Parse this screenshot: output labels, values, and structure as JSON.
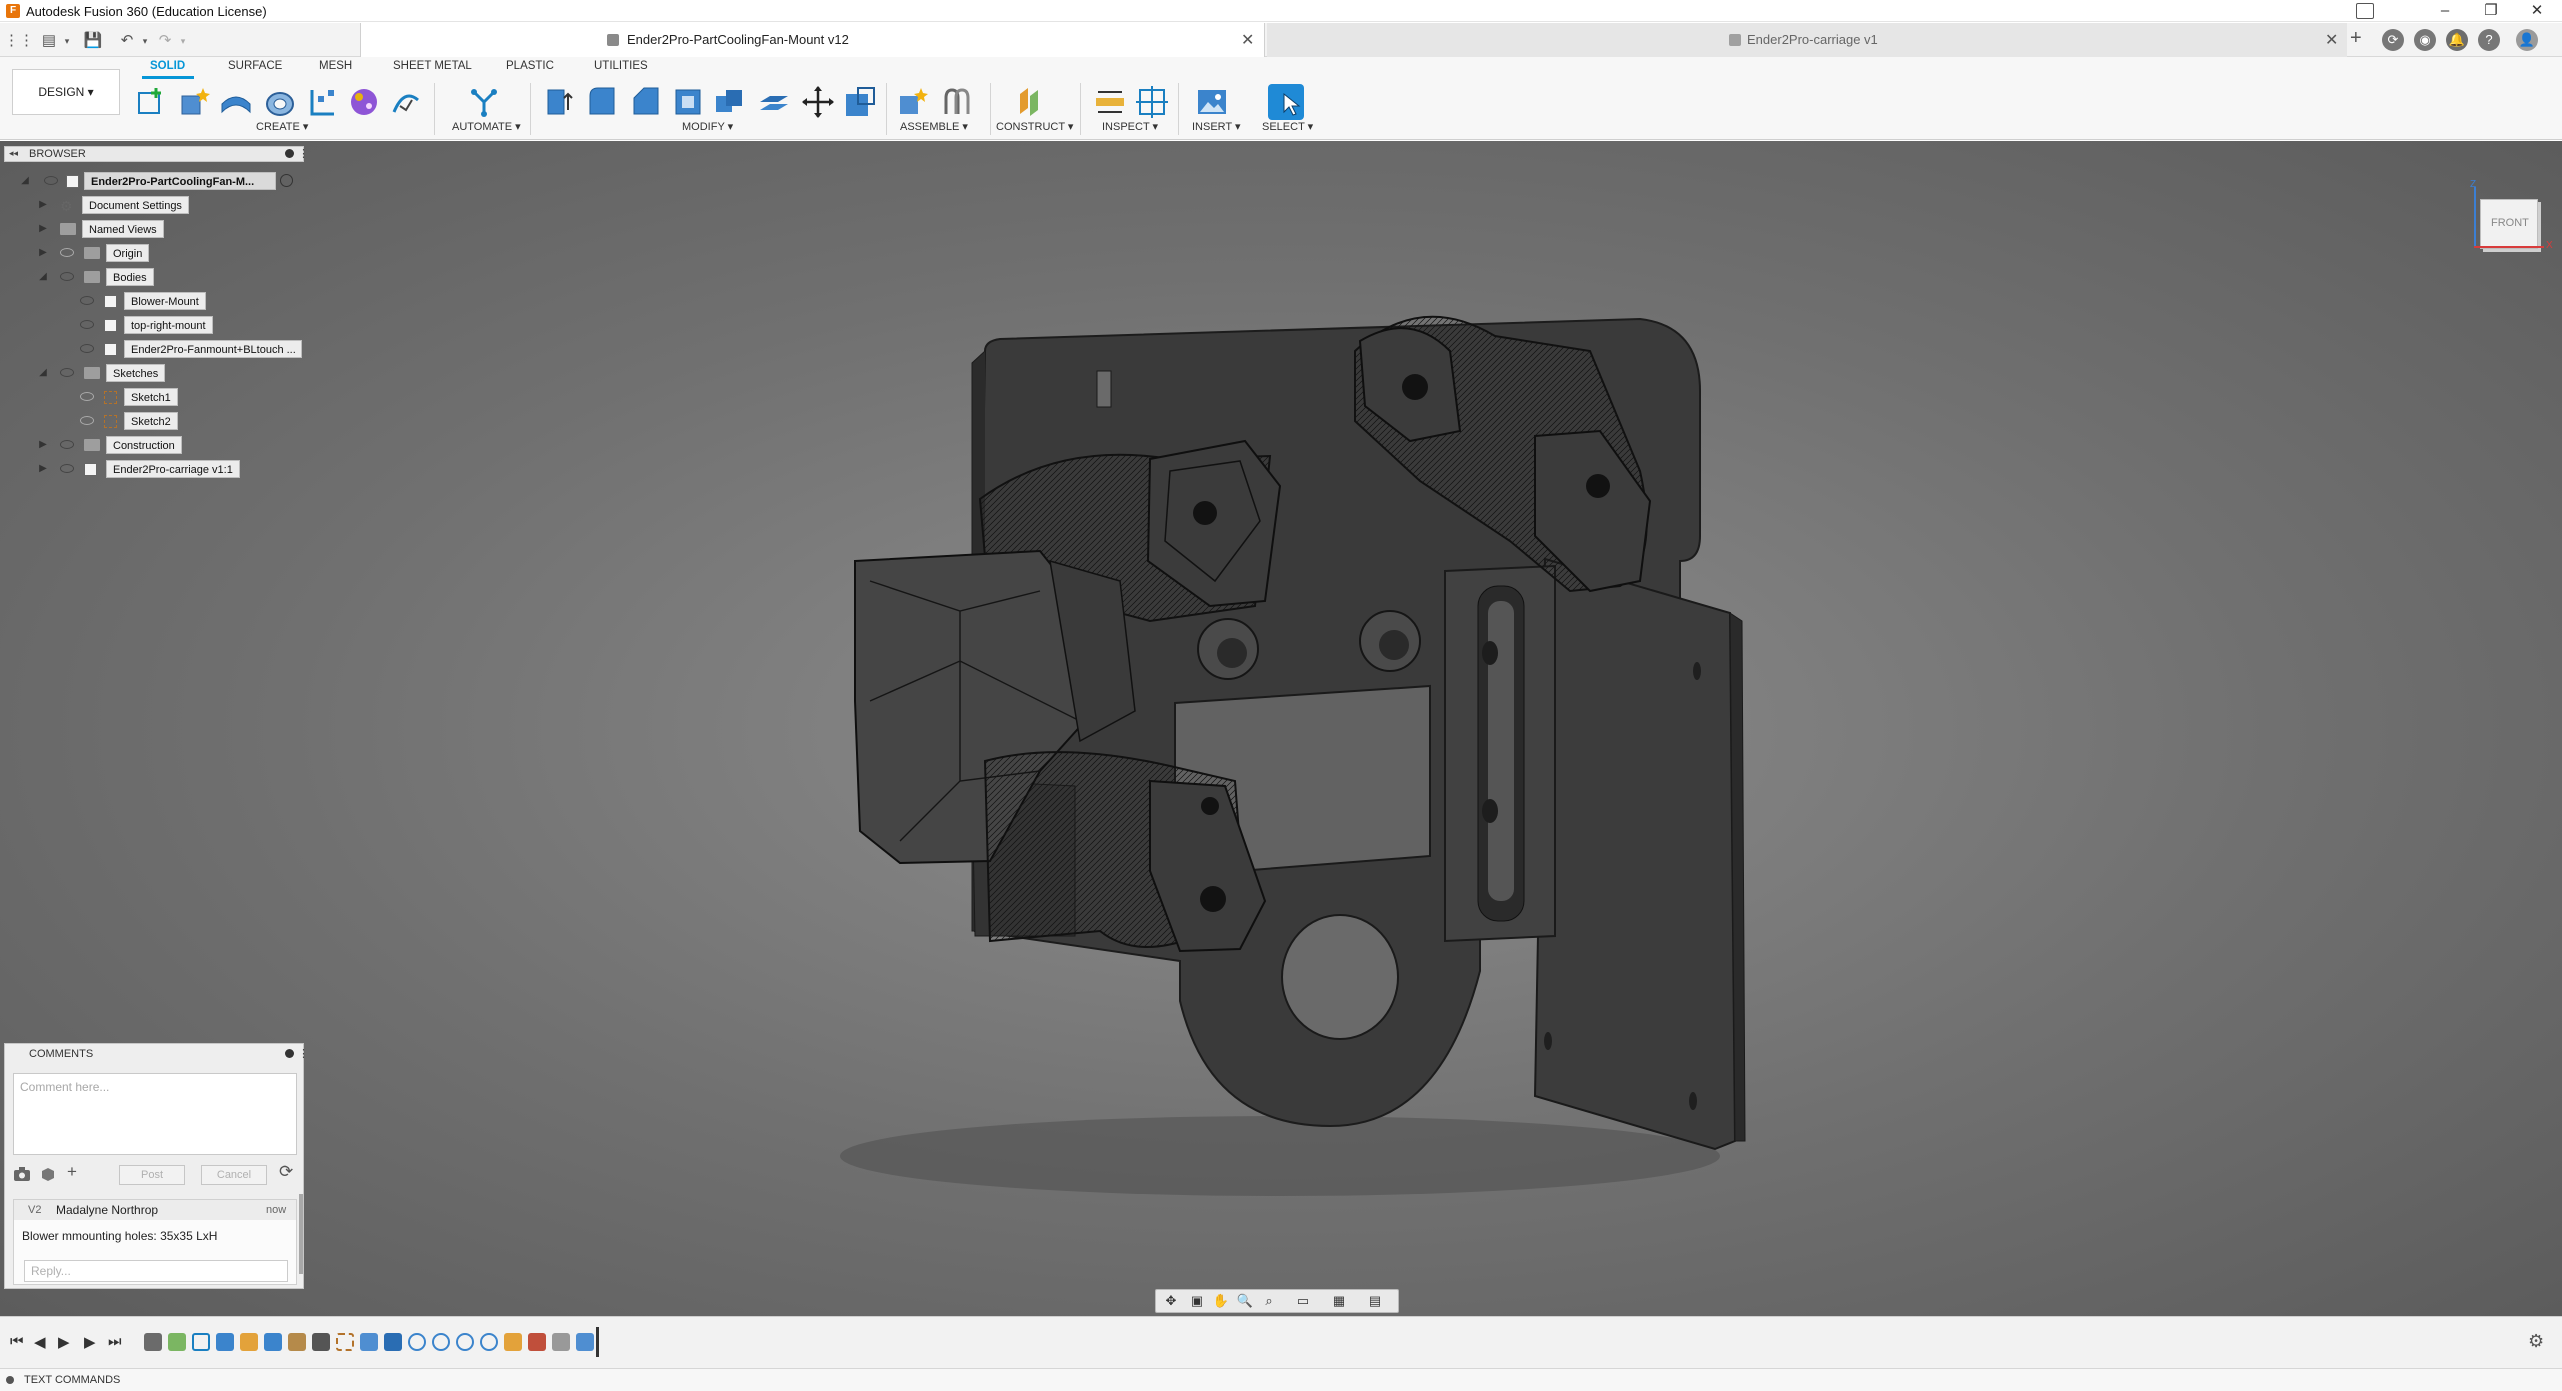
{
  "app": {
    "title": "Autodesk Fusion 360 (Education License)",
    "logo_letter": "F"
  },
  "window_controls": {
    "minimize": "–",
    "restore": "❐",
    "close": "✕"
  },
  "quick_access": {
    "grid": "⋮⋮",
    "file": "▤",
    "save": "💾",
    "undo": "↶",
    "redo": "↷",
    "dropdown": "▾"
  },
  "doc_tabs": [
    {
      "label": "Ender2Pro-PartCoolingFan-Mount v12",
      "active": true
    },
    {
      "label": "Ender2Pro-carriage v1",
      "active": false
    }
  ],
  "top_icons": {
    "new_tab": "+",
    "jobs": "⟳",
    "online": "◉",
    "notifications": "🔔",
    "help": "?",
    "profile": "👤"
  },
  "ribbon": {
    "workspace": "DESIGN ▾",
    "tabs": [
      "SOLID",
      "SURFACE",
      "MESH",
      "SHEET METAL",
      "PLASTIC",
      "UTILITIES"
    ],
    "groups": [
      "CREATE ▾",
      "AUTOMATE ▾",
      "MODIFY ▾",
      "ASSEMBLE ▾",
      "CONSTRUCT ▾",
      "INSPECT ▾",
      "INSERT ▾",
      "SELECT ▾"
    ]
  },
  "browser": {
    "header": "BROWSER",
    "collapse": "◂◂",
    "items": [
      {
        "label": "Ender2Pro-PartCoolingFan-M...",
        "kind": "root"
      },
      {
        "label": "Document Settings",
        "kind": "settings"
      },
      {
        "label": "Named Views",
        "kind": "folder"
      },
      {
        "label": "Origin",
        "kind": "folder"
      },
      {
        "label": "Bodies",
        "kind": "folder"
      },
      {
        "label": "Blower-Mount",
        "kind": "body"
      },
      {
        "label": "top-right-mount",
        "kind": "body"
      },
      {
        "label": "Ender2Pro-Fanmount+BLtouch ...",
        "kind": "body"
      },
      {
        "label": "Sketches",
        "kind": "folder"
      },
      {
        "label": "Sketch1",
        "kind": "sketch"
      },
      {
        "label": "Sketch2",
        "kind": "sketch"
      },
      {
        "label": "Construction",
        "kind": "folder"
      },
      {
        "label": "Ender2Pro-carriage v1:1",
        "kind": "component"
      }
    ]
  },
  "comments": {
    "header": "COMMENTS",
    "placeholder": "Comment here...",
    "post": "Post",
    "cancel": "Cancel",
    "thread": {
      "version": "V2",
      "author": "Madalyne Northrop",
      "time": "now",
      "text": "Blower mmounting holes: 35x35 LxH",
      "reply_placeholder": "Reply..."
    }
  },
  "viewcube": {
    "face": "FRONT",
    "axis_x": "X",
    "axis_z": "Z"
  },
  "timeline": {
    "first": "⏮",
    "prev": "◀",
    "play": "▶",
    "next": "▶",
    "last": "⏭",
    "settings": "⚙"
  },
  "text_commands": {
    "label": "TEXT COMMANDS"
  },
  "colors": {
    "accent": "#0696d7",
    "viewport": "#707070",
    "model": "#3a3a3a"
  }
}
